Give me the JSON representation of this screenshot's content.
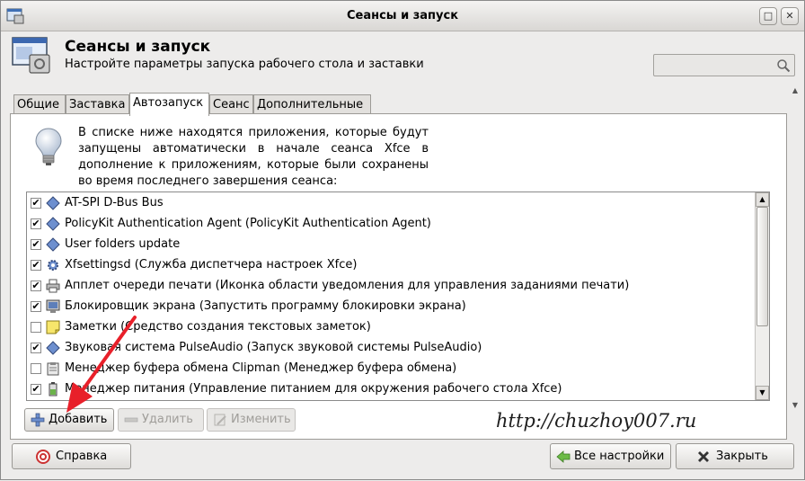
{
  "window": {
    "title": "Сеансы и запуск",
    "maximize_glyph": "□",
    "close_glyph": "✕"
  },
  "header": {
    "title": "Сеансы и запуск",
    "subtitle": "Настройте параметры запуска рабочего стола и заставки",
    "search": {
      "value": "",
      "placeholder": ""
    }
  },
  "tabs": [
    {
      "label": "Общие",
      "active": false
    },
    {
      "label": "Заставка",
      "active": false
    },
    {
      "label": "Автозапуск",
      "active": true
    },
    {
      "label": "Сеанс",
      "active": false
    },
    {
      "label": "Дополнительные",
      "active": false
    }
  ],
  "autostart": {
    "info_text": "В списке ниже находятся приложения, которые будут запущены автоматически в начале сеанса Xfce в дополнение к приложениям, которые были сохранены во время последнего завершения сеанса:",
    "items": [
      {
        "checked": true,
        "icon": "diamond-icon",
        "label": "AT-SPI D-Bus Bus"
      },
      {
        "checked": true,
        "icon": "diamond-icon",
        "label": "PolicyKit Authentication Agent (PolicyKit Authentication Agent)"
      },
      {
        "checked": true,
        "icon": "diamond-icon",
        "label": "User folders update"
      },
      {
        "checked": true,
        "icon": "gear-icon",
        "label": "Xfsettingsd (Служба диспетчера настроек Xfce)"
      },
      {
        "checked": true,
        "icon": "printer-icon",
        "label": "Апплет очереди печати (Иконка области уведомления для управления заданиями печати)"
      },
      {
        "checked": true,
        "icon": "monitor-icon",
        "label": "Блокировщик экрана (Запустить программу блокировки экрана)"
      },
      {
        "checked": false,
        "icon": "note-icon",
        "label": "Заметки (Средство создания текстовых заметок)"
      },
      {
        "checked": true,
        "icon": "diamond-icon",
        "label": "Звуковая система PulseAudio (Запуск звуковой системы PulseAudio)"
      },
      {
        "checked": false,
        "icon": "clipboard-icon",
        "label": "Менеджер буфера обмена Clipman (Менеджер буфера обмена)"
      },
      {
        "checked": true,
        "icon": "battery-icon",
        "label": "Менеджер питания (Управление питанием для окружения рабочего стола Xfce)"
      }
    ],
    "buttons": {
      "add": "Добавить",
      "remove": "Удалить",
      "edit": "Изменить"
    }
  },
  "watermark": "http://chuzhoy007.ru",
  "footer": {
    "help": "Справка",
    "all_settings": "Все настройки",
    "close": "Закрыть"
  },
  "colors": {
    "arrow": "#e8202a",
    "icon_blue": "#5b7fbf"
  }
}
